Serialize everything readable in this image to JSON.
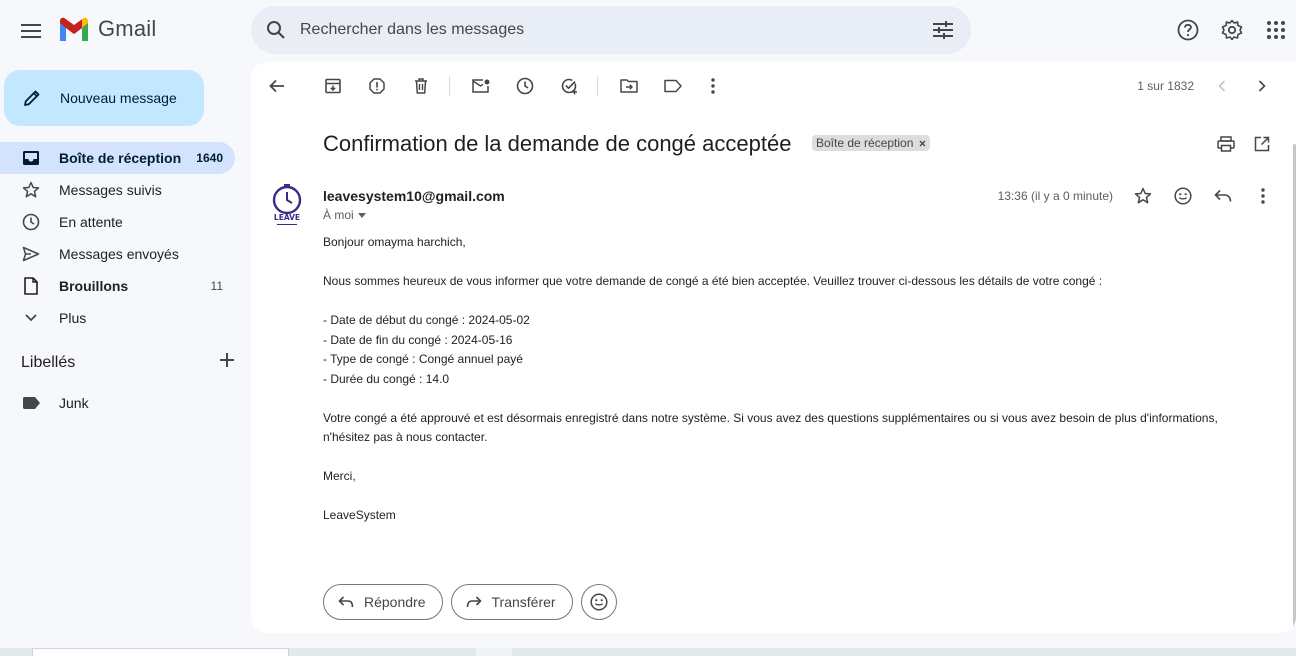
{
  "app": {
    "name": "Gmail"
  },
  "search": {
    "placeholder": "Rechercher dans les messages"
  },
  "compose": {
    "label": "Nouveau message"
  },
  "nav": [
    {
      "label": "Boîte de réception",
      "count": "1640",
      "icon": "inbox-icon"
    },
    {
      "label": "Messages suivis",
      "count": "",
      "icon": "star-icon"
    },
    {
      "label": "En attente",
      "count": "",
      "icon": "clock-icon"
    },
    {
      "label": "Messages envoyés",
      "count": "",
      "icon": "send-icon"
    },
    {
      "label": "Brouillons",
      "count": "11",
      "icon": "draft-icon"
    },
    {
      "label": "Plus",
      "count": "",
      "icon": "chevron-down-icon"
    }
  ],
  "labels": {
    "title": "Libellés",
    "items": [
      {
        "label": "Junk"
      }
    ]
  },
  "pager": {
    "text": "1 sur 1832"
  },
  "email": {
    "subject": "Confirmation de la demande de congé acceptée",
    "tag": "Boîte de réception",
    "sender": "leavesystem10@gmail.com",
    "to": "À moi",
    "time": "13:36 (il y a 0 minute)",
    "avatar_text": "LEAVE",
    "body": {
      "greeting": "Bonjour omayma harchich,",
      "intro": "Nous sommes heureux de vous informer que votre demande de congé a été bien acceptée. Veuillez trouver ci-dessous les détails de votre congé :",
      "details": [
        "- Date de début du congé : 2024-05-02",
        "- Date de fin du congé : 2024-05-16",
        "- Type de congé : Congé annuel payé",
        "- Durée du congé : 14.0"
      ],
      "outro": "Votre congé a été approuvé et est désormais enregistré dans notre système. Si vous avez des questions supplémentaires ou si vous avez besoin de plus d'informations, n'hésitez pas à nous contacter.",
      "thanks": "Merci,",
      "signature": "LeaveSystem"
    }
  },
  "actions": {
    "reply": "Répondre",
    "forward": "Transférer"
  },
  "colors": {
    "accent": "#c2e7ff",
    "active_nav": "#d3e3fd",
    "search_bg": "#e9eef6"
  }
}
